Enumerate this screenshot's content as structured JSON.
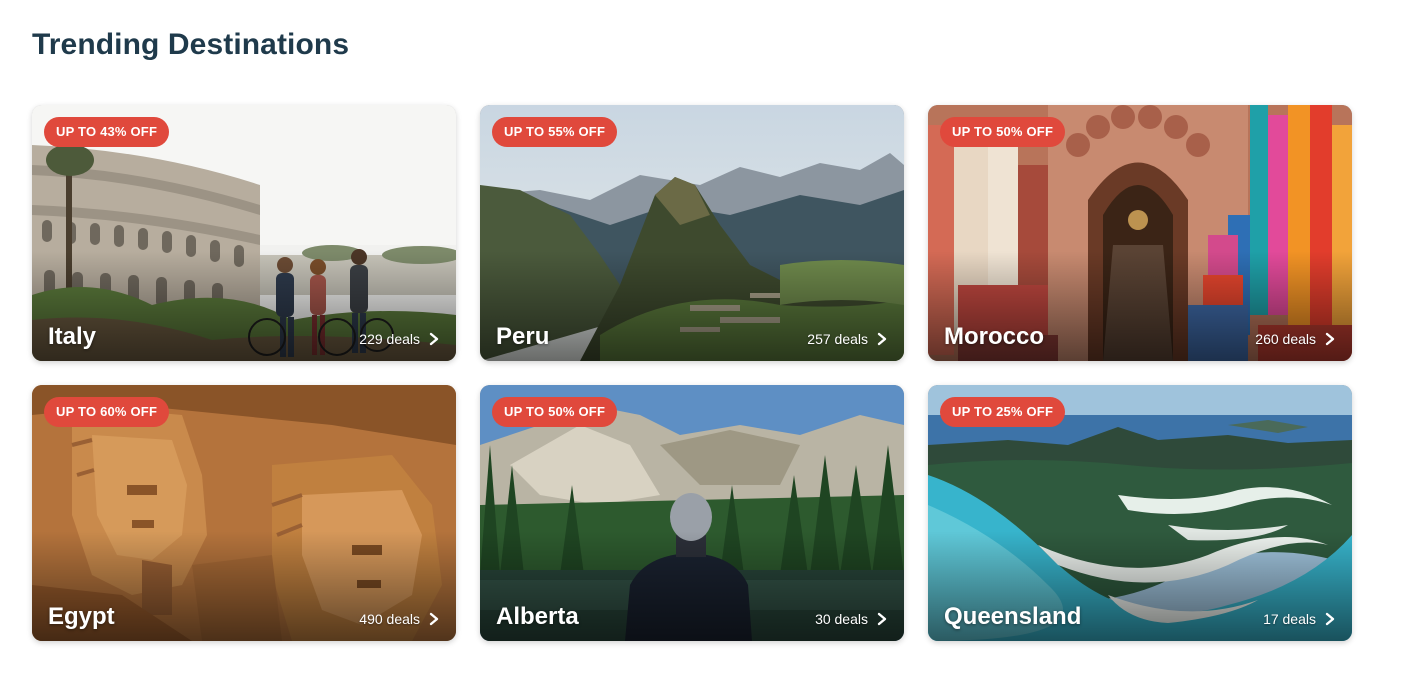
{
  "section": {
    "title": "Trending Destinations"
  },
  "colors": {
    "title": "#1f3a4b",
    "badge": "#e0493c",
    "card_text": "#ffffff"
  },
  "destinations": [
    {
      "name": "Italy",
      "badge": "UP TO 43% OFF",
      "deals": "229 deals",
      "image_subject": "colosseum-with-cyclists"
    },
    {
      "name": "Peru",
      "badge": "UP TO 55% OFF",
      "deals": "257 deals",
      "image_subject": "machu-picchu-mountains"
    },
    {
      "name": "Morocco",
      "badge": "UP TO 50% OFF",
      "deals": "260 deals",
      "image_subject": "souk-market-archway"
    },
    {
      "name": "Egypt",
      "badge": "UP TO 60% OFF",
      "deals": "490 deals",
      "image_subject": "abu-simbel-statues"
    },
    {
      "name": "Alberta",
      "badge": "UP TO 50% OFF",
      "deals": "30 deals",
      "image_subject": "hiker-at-mountain-lake"
    },
    {
      "name": "Queensland",
      "badge": "UP TO 25% OFF",
      "deals": "17 deals",
      "image_subject": "whitsunday-beach-aerial"
    }
  ]
}
